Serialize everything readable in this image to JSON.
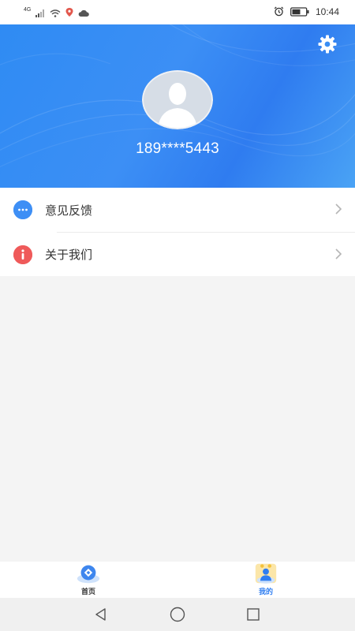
{
  "status_bar": {
    "network": "4G",
    "time": "10:44"
  },
  "profile": {
    "phone": "189****5443"
  },
  "menu": {
    "items": [
      {
        "label": "意见反馈",
        "icon": "chat-bubble-icon",
        "icon_color": "#3e8ff5"
      },
      {
        "label": "关于我们",
        "icon": "info-icon",
        "icon_color": "#ef5a5a"
      }
    ]
  },
  "bottom_nav": {
    "items": [
      {
        "label": "首页",
        "icon": "home-icon",
        "active": false
      },
      {
        "label": "我的",
        "icon": "user-icon",
        "active": true
      }
    ]
  },
  "colors": {
    "header_start": "#2f8bf3",
    "header_end": "#4aa3f5",
    "accent": "#2f7ef1",
    "background": "#f4f4f4"
  }
}
